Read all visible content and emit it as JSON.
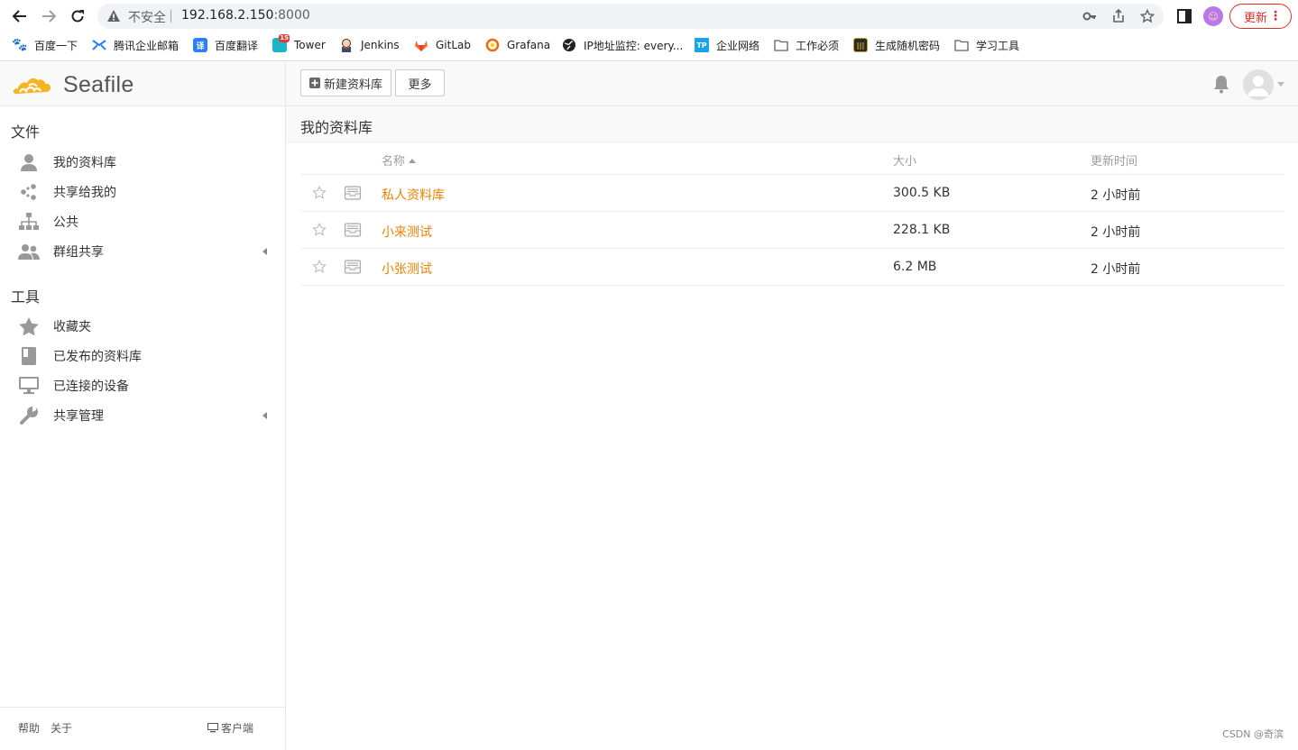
{
  "browser": {
    "insecure_label": "不安全",
    "url_host": "192.168.2.150",
    "url_port": ":8000",
    "update_label": "更新",
    "bookmarks": [
      {
        "label": "百度一下",
        "icon": "baidu-icon",
        "color": "#2932e1"
      },
      {
        "label": "腾讯企业邮箱",
        "icon": "tencent-mail-icon",
        "color": "#2a7ffb"
      },
      {
        "label": "百度翻译",
        "icon": "baidu-translate-icon",
        "color": "#2a7ffb",
        "glyph": "译"
      },
      {
        "label": "Tower",
        "icon": "tower-icon",
        "color": "#1ab6c8",
        "glyph": "15"
      },
      {
        "label": "Jenkins",
        "icon": "jenkins-icon",
        "color": "#d33833"
      },
      {
        "label": "GitLab",
        "icon": "gitlab-icon",
        "color": "#fc6d26"
      },
      {
        "label": "Grafana",
        "icon": "grafana-icon",
        "color": "#f46800"
      },
      {
        "label": "IP地址监控: every...",
        "icon": "globe-icon",
        "color": "#202124"
      },
      {
        "label": "企业网络",
        "icon": "tp-icon",
        "color": "#1aa3e8",
        "glyph": "TP"
      },
      {
        "label": "工作必须",
        "icon": "folder-icon",
        "color": "#5f6368"
      },
      {
        "label": "生成随机密码",
        "icon": "password-icon",
        "color": "#2b2b2b"
      },
      {
        "label": "学习工具",
        "icon": "folder-icon",
        "color": "#5f6368"
      }
    ]
  },
  "app": {
    "logo_text": "Seafile",
    "toolbar": {
      "new_library": "新建资料库",
      "more": "更多"
    }
  },
  "sidebar": {
    "files_heading": "文件",
    "files_items": [
      {
        "label": "我的资料库",
        "icon": "user-icon"
      },
      {
        "label": "共享给我的",
        "icon": "share-icon"
      },
      {
        "label": "公共",
        "icon": "org-icon"
      },
      {
        "label": "群组共享",
        "icon": "group-icon",
        "expandable": true
      }
    ],
    "tools_heading": "工具",
    "tools_items": [
      {
        "label": "收藏夹",
        "icon": "star-icon"
      },
      {
        "label": "已发布的资料库",
        "icon": "book-icon"
      },
      {
        "label": "已连接的设备",
        "icon": "monitor-icon"
      },
      {
        "label": "共享管理",
        "icon": "wrench-icon",
        "expandable": true
      }
    ],
    "footer": {
      "help": "帮助",
      "about": "关于",
      "client": "客户端"
    }
  },
  "main": {
    "title": "我的资料库",
    "columns": {
      "name": "名称",
      "size": "大小",
      "updated": "更新时间"
    },
    "rows": [
      {
        "name": "私人资料库",
        "size": "300.5 KB",
        "updated": "2 小时前"
      },
      {
        "name": "小来测试",
        "size": "228.1 KB",
        "updated": "2 小时前"
      },
      {
        "name": "小张测试",
        "size": "6.2 MB",
        "updated": "2 小时前"
      }
    ]
  },
  "watermark": "CSDN @奇滨",
  "colors": {
    "accent": "#eb8205",
    "logo_yellow": "#f6b322"
  }
}
